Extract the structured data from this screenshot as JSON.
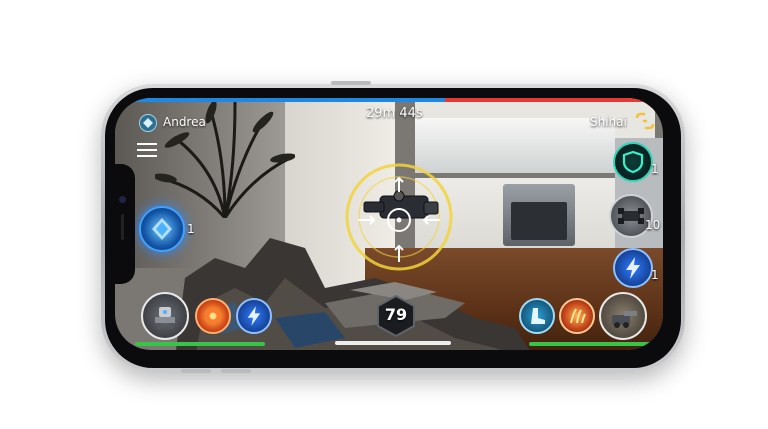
{
  "hud": {
    "timer": "29m 44s",
    "player_left": {
      "name": "Andrea"
    },
    "player_right": {
      "name": "Shihai"
    },
    "energy": "79",
    "colors": {
      "team_blue": "#1e88e5",
      "team_red": "#e53935",
      "health_green": "#38c446",
      "target_ring": "#f2d43b"
    }
  },
  "right_abilities": [
    {
      "icon": "shield-icon",
      "count": "1"
    },
    {
      "icon": "drone-unit-icon",
      "count": "10"
    },
    {
      "icon": "lightning-icon",
      "count": "1"
    }
  ],
  "left_abilities": [
    {
      "icon": "crystal-orb-icon",
      "count": "1"
    }
  ],
  "bottom_left_abilities": [
    {
      "icon": "mech-unit-icon"
    },
    {
      "icon": "fireball-icon"
    },
    {
      "icon": "lightning-icon"
    }
  ],
  "bottom_right_abilities": [
    {
      "icon": "boot-icon"
    },
    {
      "icon": "fire-claw-icon"
    },
    {
      "icon": "cannon-unit-icon"
    }
  ]
}
